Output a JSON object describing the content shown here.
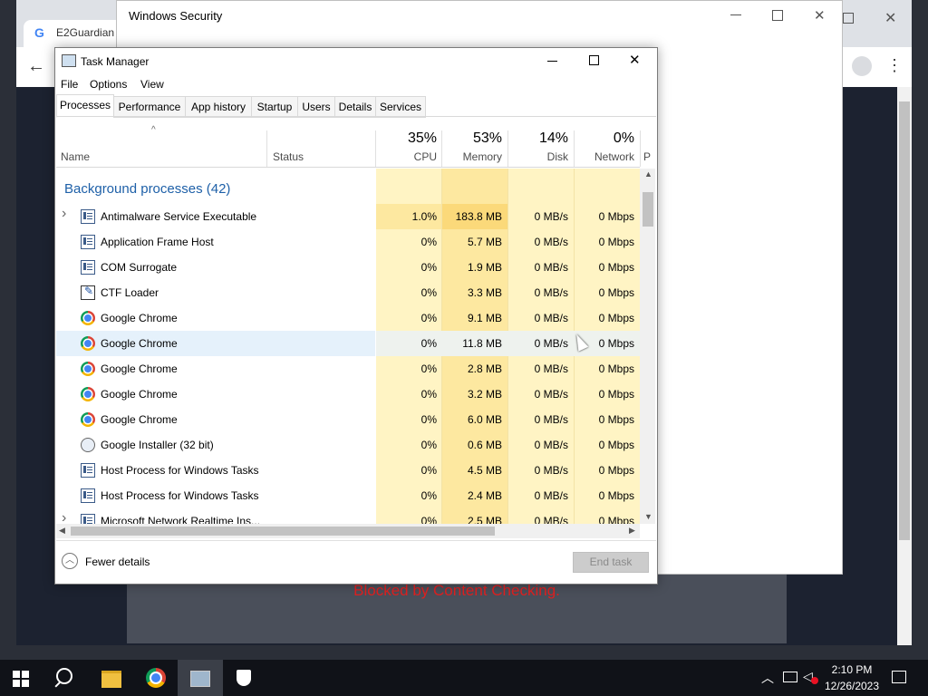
{
  "browser": {
    "tab_title": "E2Guardian",
    "blocked_message": "Blocked by Content Checking."
  },
  "security_window": {
    "title": "Windows Security"
  },
  "task_manager": {
    "title": "Task Manager",
    "menu": [
      "File",
      "Options",
      "View"
    ],
    "tabs": [
      "Processes",
      "Performance",
      "App history",
      "Startup",
      "Users",
      "Details",
      "Services"
    ],
    "active_tab": "Processes",
    "columns": {
      "name": "Name",
      "status": "Status",
      "cpu_pct": "35%",
      "cpu": "CPU",
      "mem_pct": "53%",
      "memory": "Memory",
      "disk_pct": "14%",
      "disk": "Disk",
      "net_pct": "0%",
      "network": "Network",
      "power": "P"
    },
    "group_title": "Background processes (42)",
    "rows": [
      {
        "name": "Antimalware Service Executable",
        "icon": "app-icon",
        "expandable": true,
        "cpu": "1.0%",
        "mem": "183.8 MB",
        "disk": "0 MB/s",
        "net": "0 Mbps"
      },
      {
        "name": "Application Frame Host",
        "icon": "app-icon",
        "expandable": false,
        "cpu": "0%",
        "mem": "5.7 MB",
        "disk": "0 MB/s",
        "net": "0 Mbps"
      },
      {
        "name": "COM Surrogate",
        "icon": "app-icon",
        "expandable": false,
        "cpu": "0%",
        "mem": "1.9 MB",
        "disk": "0 MB/s",
        "net": "0 Mbps"
      },
      {
        "name": "CTF Loader",
        "icon": "pen-icon",
        "expandable": false,
        "cpu": "0%",
        "mem": "3.3 MB",
        "disk": "0 MB/s",
        "net": "0 Mbps"
      },
      {
        "name": "Google Chrome",
        "icon": "chrome-icon",
        "expandable": false,
        "cpu": "0%",
        "mem": "9.1 MB",
        "disk": "0 MB/s",
        "net": "0 Mbps"
      },
      {
        "name": "Google Chrome",
        "icon": "chrome-icon",
        "expandable": false,
        "cpu": "0%",
        "mem": "11.8 MB",
        "disk": "0 MB/s",
        "net": "0 Mbps"
      },
      {
        "name": "Google Chrome",
        "icon": "chrome-icon",
        "expandable": false,
        "cpu": "0%",
        "mem": "2.8 MB",
        "disk": "0 MB/s",
        "net": "0 Mbps"
      },
      {
        "name": "Google Chrome",
        "icon": "chrome-icon",
        "expandable": false,
        "cpu": "0%",
        "mem": "3.2 MB",
        "disk": "0 MB/s",
        "net": "0 Mbps"
      },
      {
        "name": "Google Chrome",
        "icon": "chrome-icon",
        "expandable": false,
        "cpu": "0%",
        "mem": "6.0 MB",
        "disk": "0 MB/s",
        "net": "0 Mbps"
      },
      {
        "name": "Google Installer (32 bit)",
        "icon": "installer-icon",
        "expandable": false,
        "cpu": "0%",
        "mem": "0.6 MB",
        "disk": "0 MB/s",
        "net": "0 Mbps"
      },
      {
        "name": "Host Process for Windows Tasks",
        "icon": "app-icon",
        "expandable": false,
        "cpu": "0%",
        "mem": "4.5 MB",
        "disk": "0 MB/s",
        "net": "0 Mbps"
      },
      {
        "name": "Host Process for Windows Tasks",
        "icon": "app-icon",
        "expandable": false,
        "cpu": "0%",
        "mem": "2.4 MB",
        "disk": "0 MB/s",
        "net": "0 Mbps"
      },
      {
        "name": "Microsoft Network Realtime Ins...",
        "icon": "app-icon",
        "expandable": true,
        "cpu": "0%",
        "mem": "2.5 MB",
        "disk": "0 MB/s",
        "net": "0 Mbps"
      }
    ],
    "fewer_details": "Fewer details",
    "end_task": "End task"
  },
  "taskbar": {
    "time": "2:10 PM",
    "date": "12/26/2023"
  },
  "colors": {
    "heat_light": "#fff4c4",
    "heat_mid": "#ffe9a6",
    "heat_strong": "#fde48a",
    "accent_blue": "#1e60a8"
  }
}
